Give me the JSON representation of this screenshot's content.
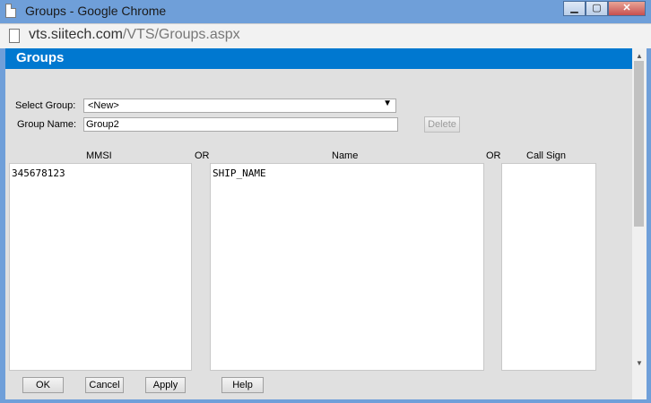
{
  "window": {
    "title": "Groups - Google Chrome",
    "controls": {
      "minimize": "▁",
      "maximize": "▢",
      "close": "✕"
    }
  },
  "address": {
    "domain": "vts.siitech.com",
    "path": "/VTS/Groups.aspx"
  },
  "header": {
    "title": "Groups"
  },
  "form": {
    "select_group_label": "Select Group:",
    "select_group_value": "<New>",
    "group_name_label": "Group Name:",
    "group_name_value": "Group2",
    "delete_label": "Delete"
  },
  "columns": {
    "mmsi_label": "MMSI",
    "or1": "OR",
    "name_label": "Name",
    "or2": "OR",
    "callsign_label": "Call Sign"
  },
  "lists": {
    "mmsi_text": "345678123",
    "name_text": "SHIP_NAME",
    "callsign_text": ""
  },
  "buttons": {
    "ok": "OK",
    "cancel": "Cancel",
    "apply": "Apply",
    "help": "Help"
  },
  "icons": {
    "select_arrow": "▼",
    "scroll_up": "▲",
    "scroll_down": "▼"
  },
  "colors": {
    "header": "#0078d0",
    "titlebar": "#6f9fd9"
  }
}
